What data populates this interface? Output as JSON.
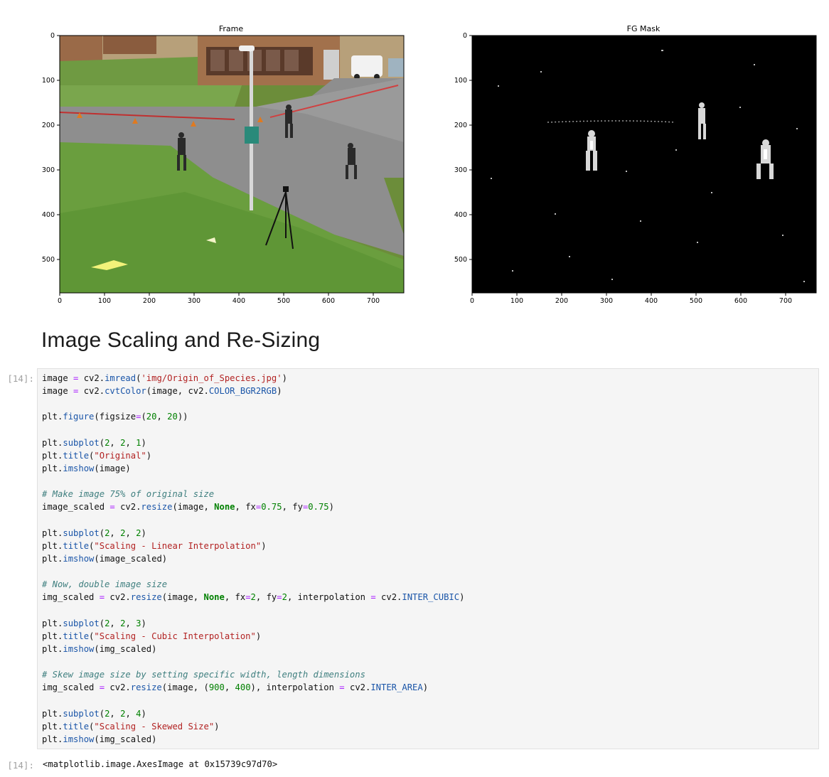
{
  "figure": {
    "left_plot": {
      "title": "Frame",
      "x_ticks": [
        "0",
        "100",
        "200",
        "300",
        "400",
        "500",
        "600",
        "700"
      ],
      "y_ticks": [
        "0",
        "100",
        "200",
        "300",
        "400",
        "500"
      ]
    },
    "right_plot": {
      "title": "FG Mask",
      "x_ticks": [
        "0",
        "100",
        "200",
        "300",
        "400",
        "500",
        "600",
        "700"
      ],
      "y_ticks": [
        "0",
        "100",
        "200",
        "300",
        "400",
        "500"
      ]
    }
  },
  "markdown": {
    "heading": "Image Scaling and Re-Sizing"
  },
  "cell": {
    "input_prompt": "[14]:",
    "output_prompt": "[14]:",
    "output_text": "<matplotlib.image.AxesImage at 0x15739c97d70>",
    "code_lines": [
      [
        [
          "",
          "image "
        ],
        [
          "op",
          "="
        ],
        [
          "",
          " cv2."
        ],
        [
          "fn",
          "imread"
        ],
        [
          "",
          "("
        ],
        [
          "st",
          "'img/Origin_of_Species.jpg'"
        ],
        [
          "",
          ")"
        ]
      ],
      [
        [
          "",
          "image "
        ],
        [
          "op",
          "="
        ],
        [
          "",
          " cv2."
        ],
        [
          "fn",
          "cvtColor"
        ],
        [
          "",
          "(image, cv2."
        ],
        [
          "at",
          "COLOR_BGR2RGB"
        ],
        [
          "",
          ")"
        ]
      ],
      [],
      [
        [
          "",
          "plt."
        ],
        [
          "fn",
          "figure"
        ],
        [
          "",
          "(figsize"
        ],
        [
          "op",
          "="
        ],
        [
          "",
          "("
        ],
        [
          "nu",
          "20"
        ],
        [
          "",
          ", "
        ],
        [
          "nu",
          "20"
        ],
        [
          "",
          "))"
        ]
      ],
      [],
      [
        [
          "",
          "plt."
        ],
        [
          "fn",
          "subplot"
        ],
        [
          "",
          "("
        ],
        [
          "nu",
          "2"
        ],
        [
          "",
          ", "
        ],
        [
          "nu",
          "2"
        ],
        [
          "",
          ", "
        ],
        [
          "nu",
          "1"
        ],
        [
          "",
          ")"
        ]
      ],
      [
        [
          "",
          "plt."
        ],
        [
          "fn",
          "title"
        ],
        [
          "",
          "("
        ],
        [
          "st",
          "\"Original\""
        ],
        [
          "",
          ")"
        ]
      ],
      [
        [
          "",
          "plt."
        ],
        [
          "fn",
          "imshow"
        ],
        [
          "",
          "(image)"
        ]
      ],
      [],
      [
        [
          "cm",
          "# Make image 75% of original size"
        ]
      ],
      [
        [
          "",
          "image_scaled "
        ],
        [
          "op",
          "="
        ],
        [
          "",
          " cv2."
        ],
        [
          "fn",
          "resize"
        ],
        [
          "",
          "(image, "
        ],
        [
          "kw",
          "None"
        ],
        [
          "",
          ", fx"
        ],
        [
          "op",
          "="
        ],
        [
          "nu",
          "0.75"
        ],
        [
          "",
          ", fy"
        ],
        [
          "op",
          "="
        ],
        [
          "nu",
          "0.75"
        ],
        [
          "",
          ")"
        ]
      ],
      [],
      [
        [
          "",
          "plt."
        ],
        [
          "fn",
          "subplot"
        ],
        [
          "",
          "("
        ],
        [
          "nu",
          "2"
        ],
        [
          "",
          ", "
        ],
        [
          "nu",
          "2"
        ],
        [
          "",
          ", "
        ],
        [
          "nu",
          "2"
        ],
        [
          "",
          ")"
        ]
      ],
      [
        [
          "",
          "plt."
        ],
        [
          "fn",
          "title"
        ],
        [
          "",
          "("
        ],
        [
          "st",
          "\"Scaling - Linear Interpolation\""
        ],
        [
          "",
          ")"
        ]
      ],
      [
        [
          "",
          "plt."
        ],
        [
          "fn",
          "imshow"
        ],
        [
          "",
          "(image_scaled)"
        ]
      ],
      [],
      [
        [
          "cm",
          "# Now, double image size"
        ]
      ],
      [
        [
          "",
          "img_scaled "
        ],
        [
          "op",
          "="
        ],
        [
          "",
          " cv2."
        ],
        [
          "fn",
          "resize"
        ],
        [
          "",
          "(image, "
        ],
        [
          "kw",
          "None"
        ],
        [
          "",
          ", fx"
        ],
        [
          "op",
          "="
        ],
        [
          "nu",
          "2"
        ],
        [
          "",
          ", fy"
        ],
        [
          "op",
          "="
        ],
        [
          "nu",
          "2"
        ],
        [
          "",
          ", interpolation "
        ],
        [
          "op",
          "="
        ],
        [
          "",
          " cv2."
        ],
        [
          "at",
          "INTER_CUBIC"
        ],
        [
          "",
          ")"
        ]
      ],
      [],
      [
        [
          "",
          "plt."
        ],
        [
          "fn",
          "subplot"
        ],
        [
          "",
          "("
        ],
        [
          "nu",
          "2"
        ],
        [
          "",
          ", "
        ],
        [
          "nu",
          "2"
        ],
        [
          "",
          ", "
        ],
        [
          "nu",
          "3"
        ],
        [
          "",
          ")"
        ]
      ],
      [
        [
          "",
          "plt."
        ],
        [
          "fn",
          "title"
        ],
        [
          "",
          "("
        ],
        [
          "st",
          "\"Scaling - Cubic Interpolation\""
        ],
        [
          "",
          ")"
        ]
      ],
      [
        [
          "",
          "plt."
        ],
        [
          "fn",
          "imshow"
        ],
        [
          "",
          "(img_scaled)"
        ]
      ],
      [],
      [
        [
          "cm",
          "# Skew image size by setting specific width, length dimensions"
        ]
      ],
      [
        [
          "",
          "img_scaled "
        ],
        [
          "op",
          "="
        ],
        [
          "",
          " cv2."
        ],
        [
          "fn",
          "resize"
        ],
        [
          "",
          "(image, ("
        ],
        [
          "nu",
          "900"
        ],
        [
          "",
          ", "
        ],
        [
          "nu",
          "400"
        ],
        [
          "",
          "), interpolation "
        ],
        [
          "op",
          "="
        ],
        [
          "",
          " cv2."
        ],
        [
          "at",
          "INTER_AREA"
        ],
        [
          "",
          ")"
        ]
      ],
      [],
      [
        [
          "",
          "plt."
        ],
        [
          "fn",
          "subplot"
        ],
        [
          "",
          "("
        ],
        [
          "nu",
          "2"
        ],
        [
          "",
          ", "
        ],
        [
          "nu",
          "2"
        ],
        [
          "",
          ", "
        ],
        [
          "nu",
          "4"
        ],
        [
          "",
          ")"
        ]
      ],
      [
        [
          "",
          "plt."
        ],
        [
          "fn",
          "title"
        ],
        [
          "",
          "("
        ],
        [
          "st",
          "\"Scaling - Skewed Size\""
        ],
        [
          "",
          ")"
        ]
      ],
      [
        [
          "",
          "plt."
        ],
        [
          "fn",
          "imshow"
        ],
        [
          "",
          "(img_scaled)"
        ]
      ]
    ]
  }
}
